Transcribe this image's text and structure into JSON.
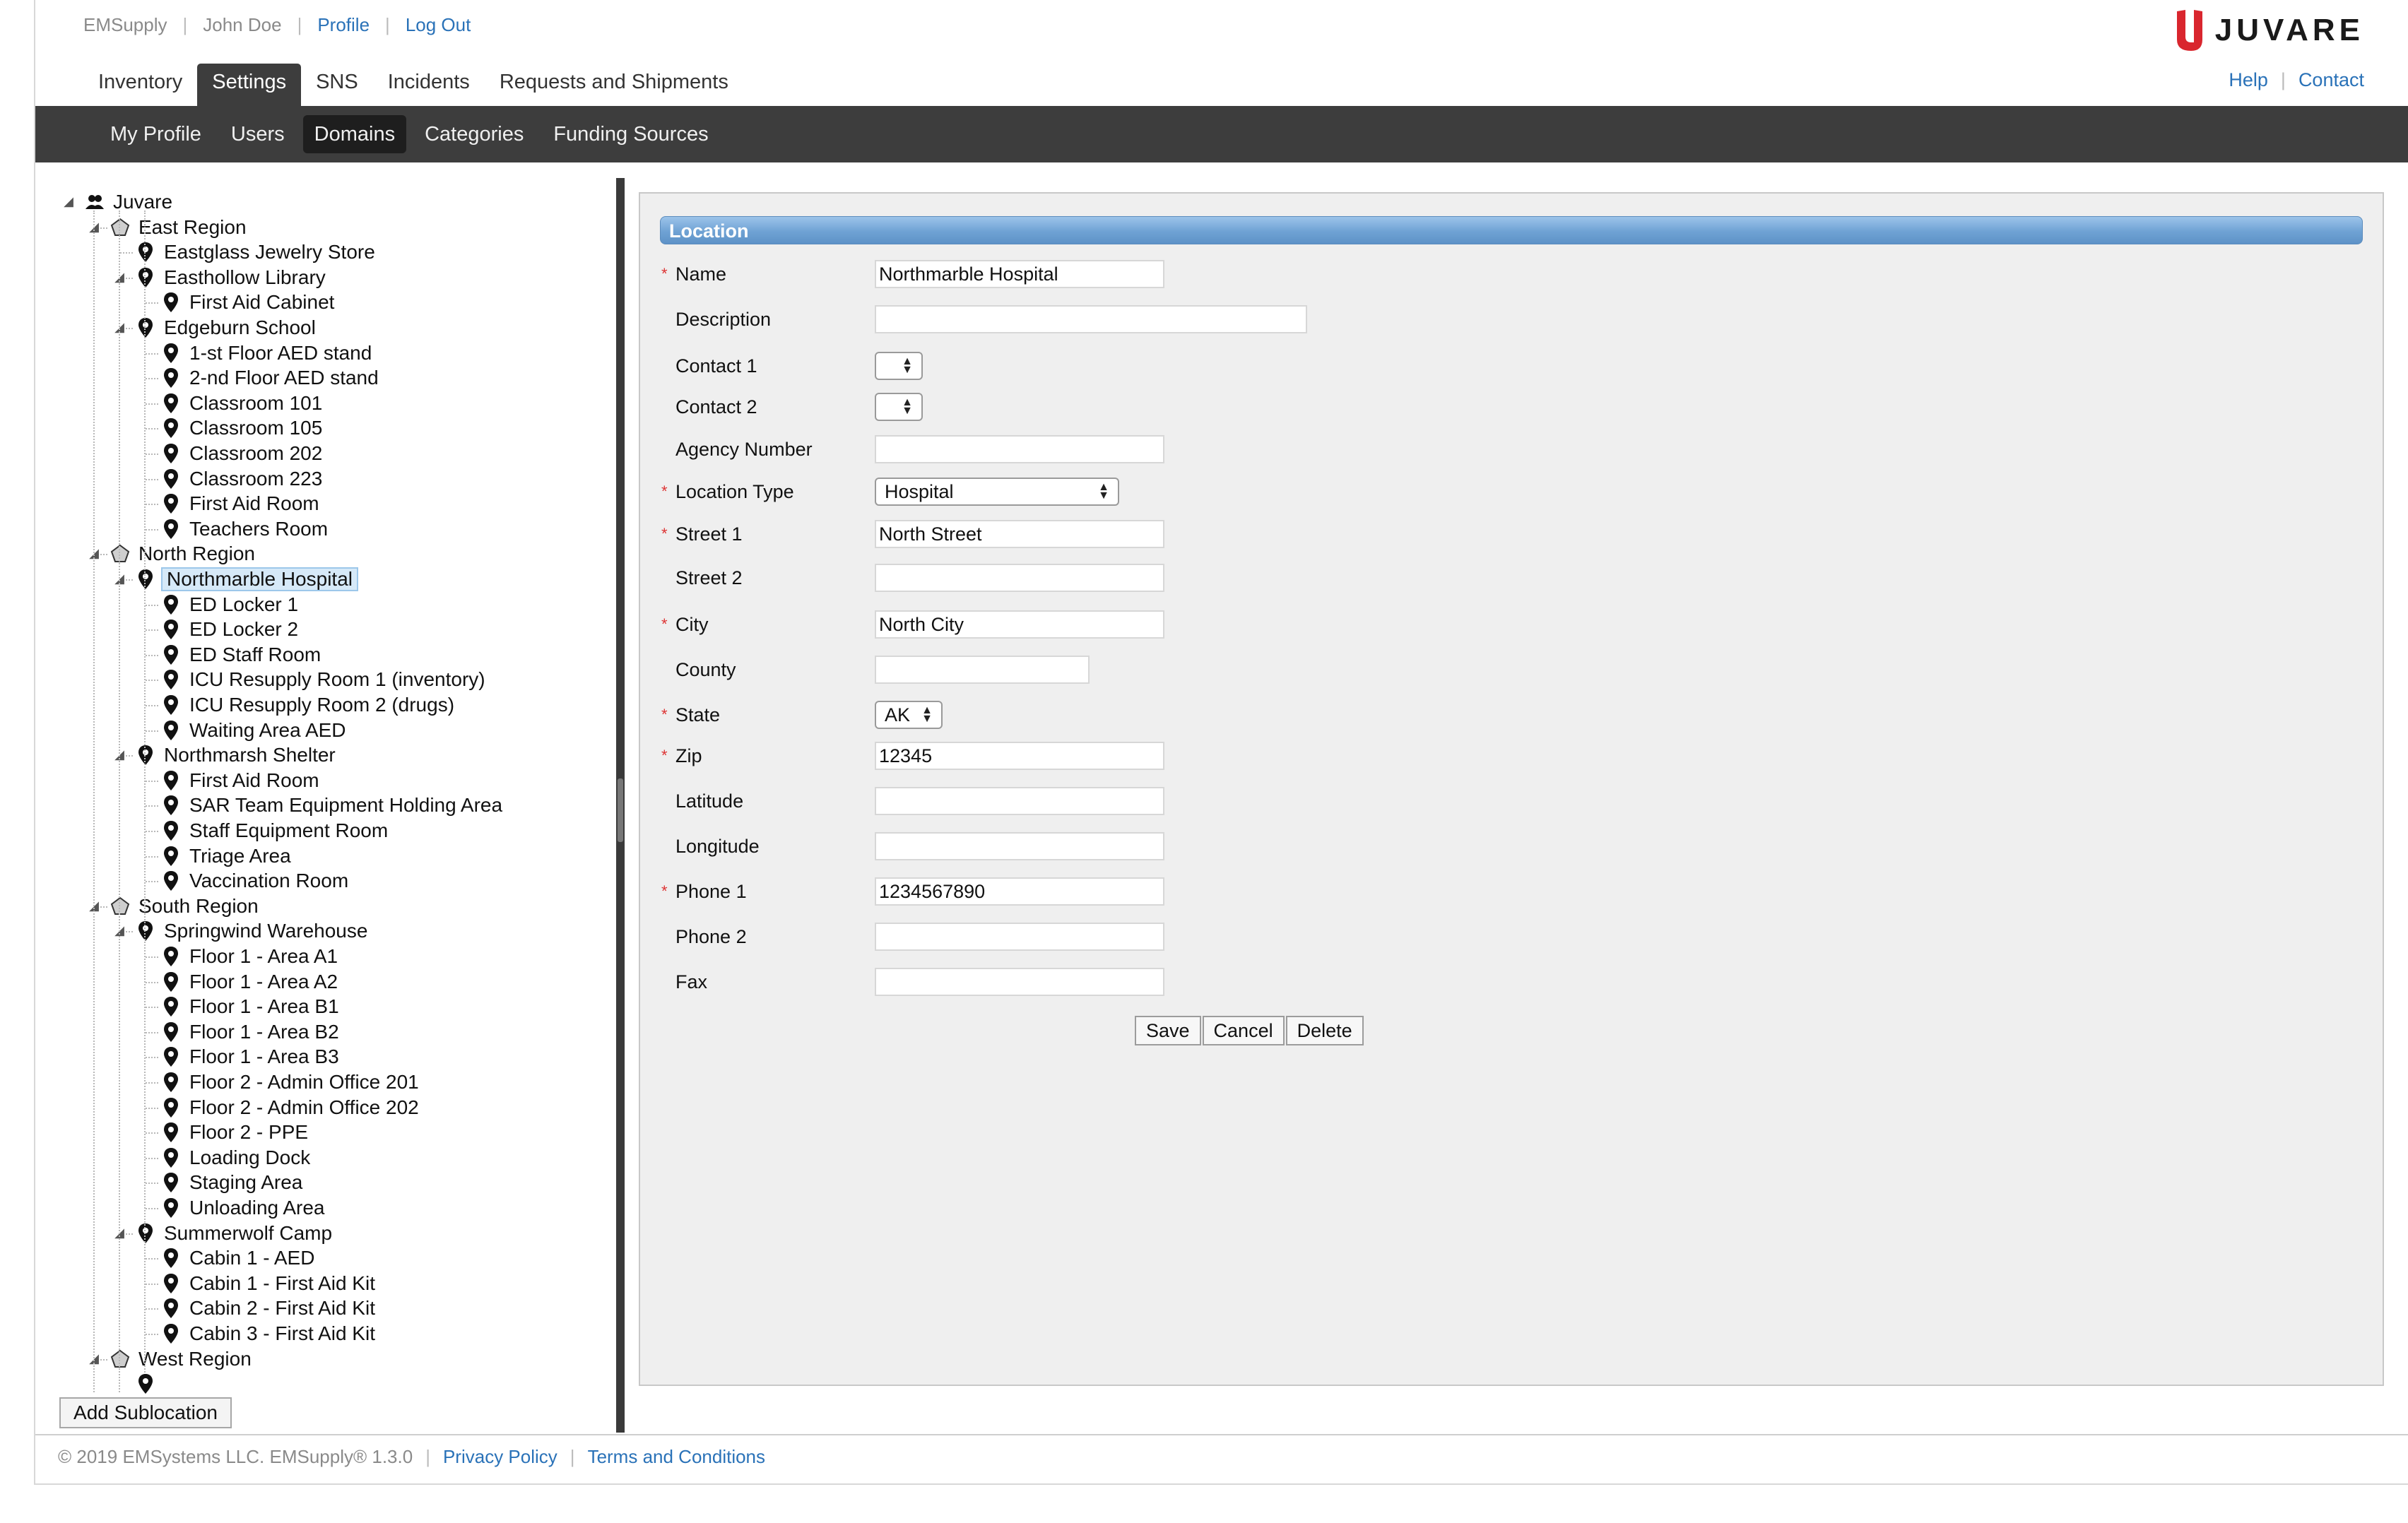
{
  "header": {
    "app_name": "EMSupply",
    "user_name": "John Doe",
    "profile_link": "Profile",
    "logout_link": "Log Out",
    "logo_text": "JUVARE",
    "help_link": "Help",
    "contact_link": "Contact",
    "brand_color": "#d9262e"
  },
  "main_nav": {
    "tabs": [
      {
        "label": "Inventory"
      },
      {
        "label": "Settings",
        "active": true
      },
      {
        "label": "SNS"
      },
      {
        "label": "Incidents"
      },
      {
        "label": "Requests and Shipments"
      }
    ]
  },
  "sub_nav": {
    "tabs": [
      {
        "label": "My Profile"
      },
      {
        "label": "Users"
      },
      {
        "label": "Domains",
        "active": true
      },
      {
        "label": "Categories"
      },
      {
        "label": "Funding Sources"
      }
    ]
  },
  "tree": {
    "nodes": [
      {
        "label": "Juvare",
        "level": 0,
        "icon": "users-icon",
        "expanded": true
      },
      {
        "label": "East Region",
        "level": 1,
        "icon": "region-icon",
        "expanded": true
      },
      {
        "label": "Eastglass Jewelry Store",
        "level": 2,
        "icon": "location-pin-icon"
      },
      {
        "label": "Easthollow Library",
        "level": 2,
        "icon": "location-pin-icon",
        "expanded": true
      },
      {
        "label": "First Aid Cabinet",
        "level": 3,
        "icon": "location-pin-icon"
      },
      {
        "label": "Edgeburn School",
        "level": 2,
        "icon": "location-pin-icon",
        "expanded": true
      },
      {
        "label": "1-st Floor AED stand",
        "level": 3,
        "icon": "location-pin-icon"
      },
      {
        "label": "2-nd Floor AED stand",
        "level": 3,
        "icon": "location-pin-icon"
      },
      {
        "label": "Classroom 101",
        "level": 3,
        "icon": "location-pin-icon"
      },
      {
        "label": "Classroom 105",
        "level": 3,
        "icon": "location-pin-icon"
      },
      {
        "label": "Classroom 202",
        "level": 3,
        "icon": "location-pin-icon"
      },
      {
        "label": "Classroom 223",
        "level": 3,
        "icon": "location-pin-icon"
      },
      {
        "label": "First Aid Room",
        "level": 3,
        "icon": "location-pin-icon"
      },
      {
        "label": "Teachers Room",
        "level": 3,
        "icon": "location-pin-icon"
      },
      {
        "label": "North Region",
        "level": 1,
        "icon": "region-icon",
        "expanded": true
      },
      {
        "label": "Northmarble Hospital",
        "level": 2,
        "icon": "location-pin-icon",
        "expanded": true,
        "selected": true
      },
      {
        "label": "ED Locker 1",
        "level": 3,
        "icon": "location-pin-icon"
      },
      {
        "label": "ED Locker 2",
        "level": 3,
        "icon": "location-pin-icon"
      },
      {
        "label": "ED Staff Room",
        "level": 3,
        "icon": "location-pin-icon"
      },
      {
        "label": "ICU Resupply Room 1 (inventory)",
        "level": 3,
        "icon": "location-pin-icon"
      },
      {
        "label": "ICU Resupply Room 2 (drugs)",
        "level": 3,
        "icon": "location-pin-icon"
      },
      {
        "label": "Waiting Area AED",
        "level": 3,
        "icon": "location-pin-icon"
      },
      {
        "label": "Northmarsh Shelter",
        "level": 2,
        "icon": "location-pin-icon",
        "expanded": true
      },
      {
        "label": "First Aid Room",
        "level": 3,
        "icon": "location-pin-icon"
      },
      {
        "label": "SAR Team Equipment Holding Area",
        "level": 3,
        "icon": "location-pin-icon"
      },
      {
        "label": "Staff Equipment Room",
        "level": 3,
        "icon": "location-pin-icon"
      },
      {
        "label": "Triage Area",
        "level": 3,
        "icon": "location-pin-icon"
      },
      {
        "label": "Vaccination Room",
        "level": 3,
        "icon": "location-pin-icon"
      },
      {
        "label": "South Region",
        "level": 1,
        "icon": "region-icon",
        "expanded": true
      },
      {
        "label": "Springwind Warehouse",
        "level": 2,
        "icon": "location-pin-icon",
        "expanded": true
      },
      {
        "label": "Floor 1 - Area A1",
        "level": 3,
        "icon": "location-pin-icon"
      },
      {
        "label": "Floor 1 - Area A2",
        "level": 3,
        "icon": "location-pin-icon"
      },
      {
        "label": "Floor 1 - Area B1",
        "level": 3,
        "icon": "location-pin-icon"
      },
      {
        "label": "Floor 1 - Area B2",
        "level": 3,
        "icon": "location-pin-icon"
      },
      {
        "label": "Floor 1 - Area B3",
        "level": 3,
        "icon": "location-pin-icon"
      },
      {
        "label": "Floor 2 - Admin Office 201",
        "level": 3,
        "icon": "location-pin-icon"
      },
      {
        "label": "Floor 2 - Admin Office 202",
        "level": 3,
        "icon": "location-pin-icon"
      },
      {
        "label": "Floor 2 - PPE",
        "level": 3,
        "icon": "location-pin-icon"
      },
      {
        "label": "Loading Dock",
        "level": 3,
        "icon": "location-pin-icon"
      },
      {
        "label": "Staging Area",
        "level": 3,
        "icon": "location-pin-icon"
      },
      {
        "label": "Unloading Area",
        "level": 3,
        "icon": "location-pin-icon"
      },
      {
        "label": "Summerwolf Camp",
        "level": 2,
        "icon": "location-pin-icon",
        "expanded": true
      },
      {
        "label": "Cabin 1 - AED",
        "level": 3,
        "icon": "location-pin-icon"
      },
      {
        "label": "Cabin 1 - First Aid Kit",
        "level": 3,
        "icon": "location-pin-icon"
      },
      {
        "label": "Cabin 2 - First Aid Kit",
        "level": 3,
        "icon": "location-pin-icon"
      },
      {
        "label": "Cabin 3 - First Aid Kit",
        "level": 3,
        "icon": "location-pin-icon"
      },
      {
        "label": "West Region",
        "level": 1,
        "icon": "region-icon",
        "expanded": true
      }
    ],
    "add_button": "Add Sublocation"
  },
  "form": {
    "title": "Location",
    "fields": {
      "name": {
        "label": "Name",
        "value": "Northmarble Hospital",
        "required": true
      },
      "description": {
        "label": "Description",
        "value": ""
      },
      "contact1": {
        "label": "Contact 1",
        "value": ""
      },
      "contact2": {
        "label": "Contact 2",
        "value": ""
      },
      "agency_number": {
        "label": "Agency Number",
        "value": ""
      },
      "location_type": {
        "label": "Location Type",
        "value": "Hospital",
        "required": true
      },
      "street1": {
        "label": "Street 1",
        "value": "North Street",
        "required": true
      },
      "street2": {
        "label": "Street 2",
        "value": ""
      },
      "city": {
        "label": "City",
        "value": "North City",
        "required": true
      },
      "county": {
        "label": "County",
        "value": ""
      },
      "state": {
        "label": "State",
        "value": "AK",
        "required": true
      },
      "zip": {
        "label": "Zip",
        "value": "12345",
        "required": true
      },
      "latitude": {
        "label": "Latitude",
        "value": ""
      },
      "longitude": {
        "label": "Longitude",
        "value": ""
      },
      "phone1": {
        "label": "Phone 1",
        "value": "1234567890",
        "required": true
      },
      "phone2": {
        "label": "Phone 2",
        "value": ""
      },
      "fax": {
        "label": "Fax",
        "value": ""
      }
    },
    "required_marker": "*",
    "buttons": {
      "save": "Save",
      "cancel": "Cancel",
      "delete": "Delete"
    }
  },
  "footer": {
    "copyright": "© 2019 EMSystems LLC. EMSupply® 1.3.0",
    "privacy": "Privacy Policy",
    "terms": "Terms and Conditions"
  }
}
